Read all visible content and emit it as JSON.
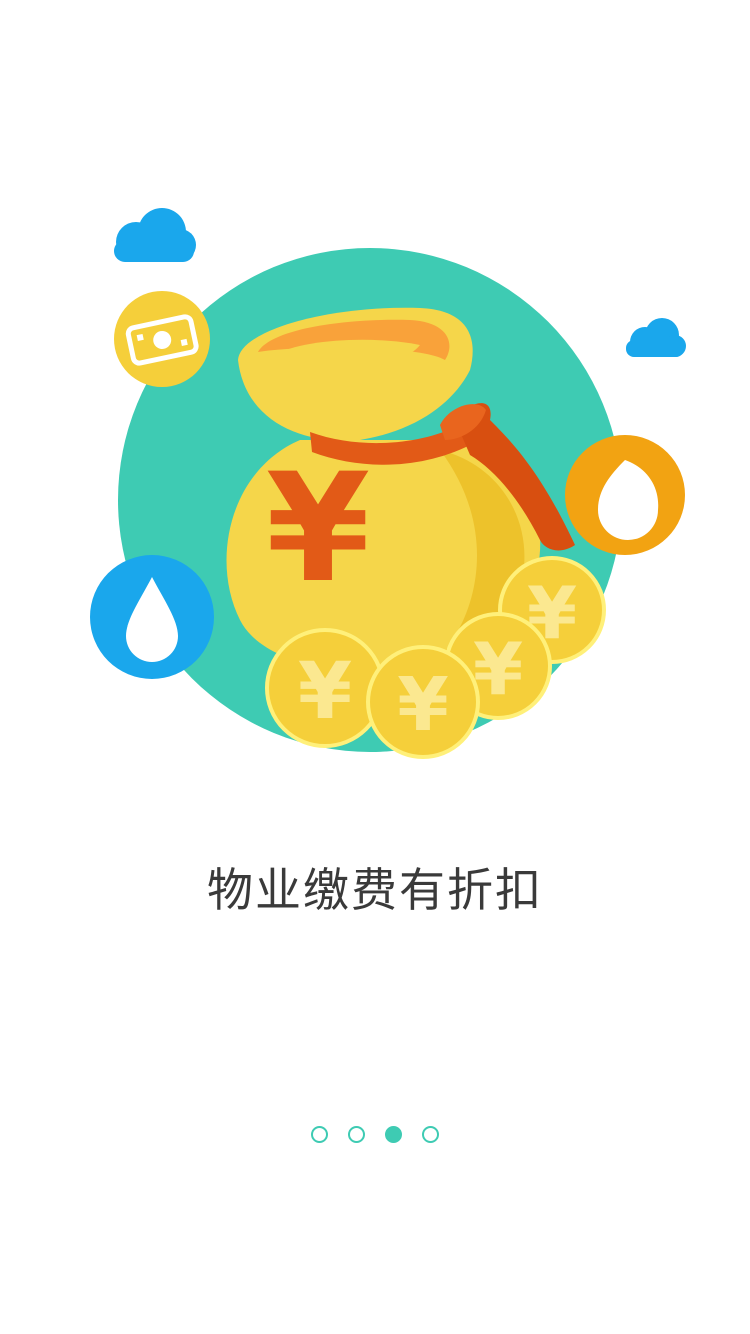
{
  "onboarding": {
    "caption": "物业缴费有折扣",
    "illustration_icon": "money-bag-with-yuan-coins",
    "coin_symbol": "¥",
    "bag_symbol": "¥",
    "colors": {
      "teal": "#3ecbb3",
      "blue": "#1aa7ec",
      "gold": "#f5cf3a",
      "orange": "#f2a312",
      "red": "#e25a17"
    }
  },
  "pager": {
    "total": 4,
    "current_index": 2
  }
}
